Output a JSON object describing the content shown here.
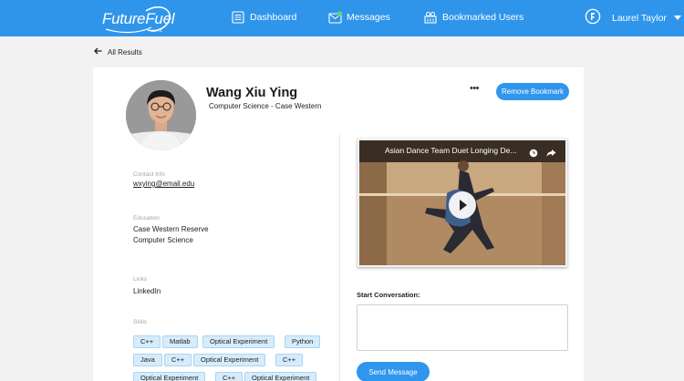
{
  "header": {
    "logo_text": "FutureFuel",
    "logo_badge": "BETA",
    "nav": [
      {
        "label": "Dashboard",
        "icon": "dashboard-icon"
      },
      {
        "label": "Messages",
        "icon": "messages-icon"
      },
      {
        "label": "Bookmarked Users",
        "icon": "bookmarked-users-icon"
      }
    ],
    "user_name": "Laurel Taylor",
    "user_icon": "user-avatar-icon",
    "accent_color": "#2f95ea"
  },
  "back_link": {
    "label": "All Results"
  },
  "profile": {
    "name": "Wang Xiu Ying",
    "subtitle": "Computer Science - Case Western",
    "more_label": "•••",
    "remove_bookmark_label": "Remove Bookmark",
    "contact": {
      "label": "Contact Info",
      "email": "wxying@email.edu"
    },
    "education": {
      "label": "Education",
      "school": "Case Western Reserve",
      "major": "Computer Science"
    },
    "links": {
      "label": "Links",
      "items": [
        "LinkedIn"
      ]
    },
    "skills": {
      "label": "Skills",
      "items": [
        "C++",
        "Matlab",
        "Optical Experiment",
        "Python",
        "Java",
        "C++",
        "Optical Experiment",
        "C++",
        "Optical Experiment",
        "C++",
        "Optical Experiment"
      ]
    }
  },
  "video": {
    "title": "Asian Dance Team Duet Longing De..."
  },
  "conversation": {
    "label": "Start Conversation:",
    "placeholder": "",
    "send_label": "Send Message"
  }
}
